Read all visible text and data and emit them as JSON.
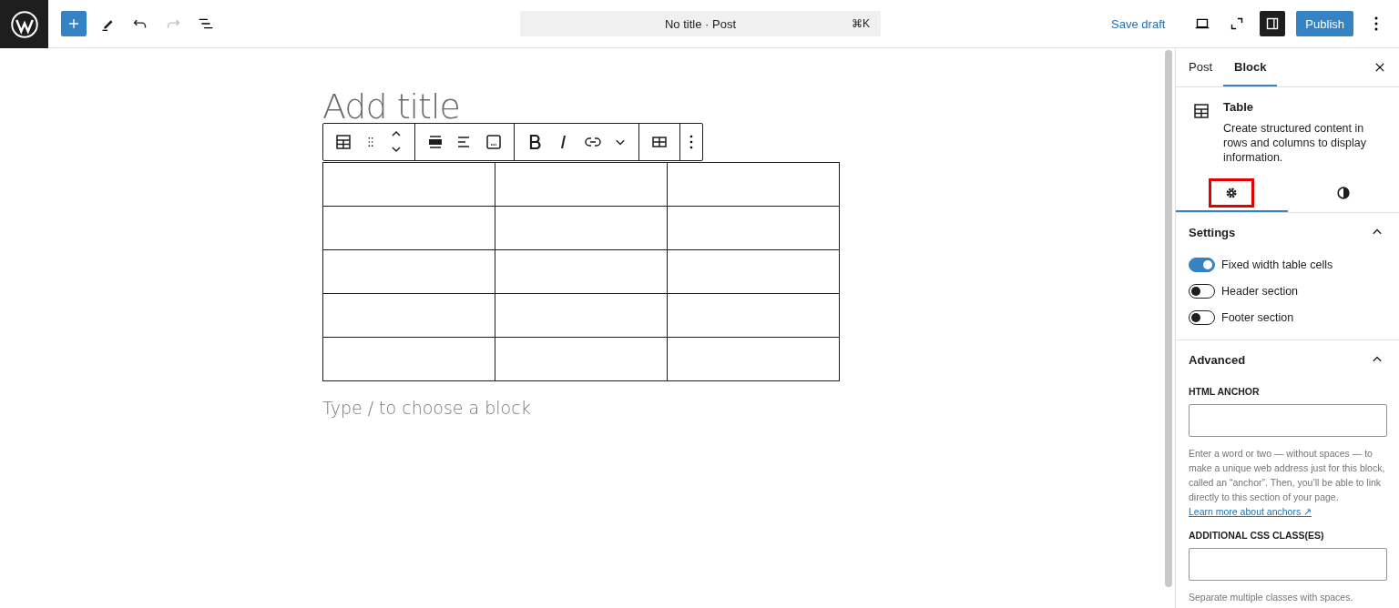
{
  "top_bar": {
    "command_center": {
      "title": "No title · Post",
      "shortcut": "⌘K"
    },
    "save_draft": "Save draft",
    "publish": "Publish",
    "undo_disabled": false,
    "redo_disabled": true,
    "sidebar_toggle_on": true
  },
  "editor": {
    "title_placeholder": "Add title",
    "table": {
      "rows": [
        {
          "cells": [
            {
              "kind": "empty"
            },
            {
              "kind": "empty"
            },
            {
              "kind": "empty"
            }
          ]
        },
        {
          "cells": [
            {
              "kind": "empty"
            },
            {
              "kind": "empty"
            },
            {
              "kind": "empty"
            }
          ]
        },
        {
          "cells": [
            {
              "kind": "empty"
            },
            {
              "kind": "empty"
            },
            {
              "kind": "empty"
            }
          ]
        },
        {
          "cells": [
            {
              "kind": "empty"
            },
            {
              "kind": "empty"
            },
            {
              "kind": "empty"
            }
          ]
        },
        {
          "cells": [
            {
              "kind": "empty"
            },
            {
              "kind": "empty"
            },
            {
              "kind": "empty"
            }
          ]
        }
      ]
    },
    "appender_placeholder": "Type / to choose a block"
  },
  "sidebar": {
    "tabs": [
      {
        "label": "Post",
        "selected": false
      },
      {
        "label": "Block",
        "selected": true
      }
    ],
    "block": {
      "name": "Table",
      "description": "Create structured content in rows and columns to display information."
    },
    "inspector_tabs": [
      {
        "kind": "settings",
        "selected": true,
        "highlighted": true
      },
      {
        "kind": "styles",
        "selected": false,
        "highlighted": false
      }
    ],
    "settings": {
      "title": "Settings",
      "expanded": true,
      "toggles": [
        {
          "label": "Fixed width table cells",
          "on": true
        },
        {
          "label": "Header section",
          "on": false
        },
        {
          "label": "Footer section",
          "on": false
        }
      ]
    },
    "advanced": {
      "title": "Advanced",
      "expanded": true,
      "anchor_label": "HTML ANCHOR",
      "anchor_help": "Enter a word or two — without spaces — to make a unique web address just for this block, called an “anchor”. Then, you’ll be able to link directly to this section of your page.",
      "anchor_link": "Learn more about anchors ↗",
      "css_label": "ADDITIONAL CSS CLASS(ES)",
      "css_help": "Separate multiple classes with spaces."
    }
  }
}
